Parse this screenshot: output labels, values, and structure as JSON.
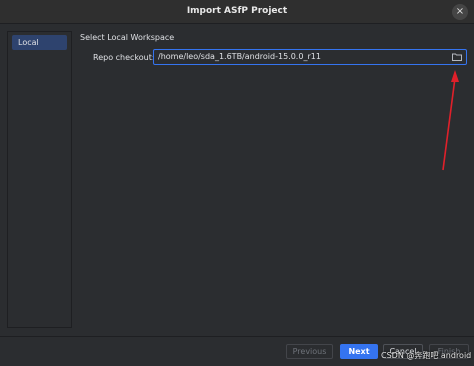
{
  "window": {
    "title": "Import ASfP Project",
    "close_glyph": "×"
  },
  "sidebar": {
    "items": [
      {
        "label": "Local",
        "selected": true
      }
    ]
  },
  "main": {
    "section_title": "Select Local Workspace",
    "repo_checkout_label": "Repo checkout:",
    "repo_checkout_value": "/home/leo/sda_1.6TB/android-15.0.0_r11",
    "browse_icon": "folder-icon"
  },
  "footer": {
    "previous_label": "Previous",
    "next_label": "Next",
    "cancel_label": "Cancel",
    "finish_label": "Finish"
  },
  "watermark": "CSDN @奔跑吧 android",
  "colors": {
    "background": "#2b2d30",
    "accent": "#3574f0",
    "selection": "#2e436e",
    "annotation_arrow": "#e0202a"
  }
}
